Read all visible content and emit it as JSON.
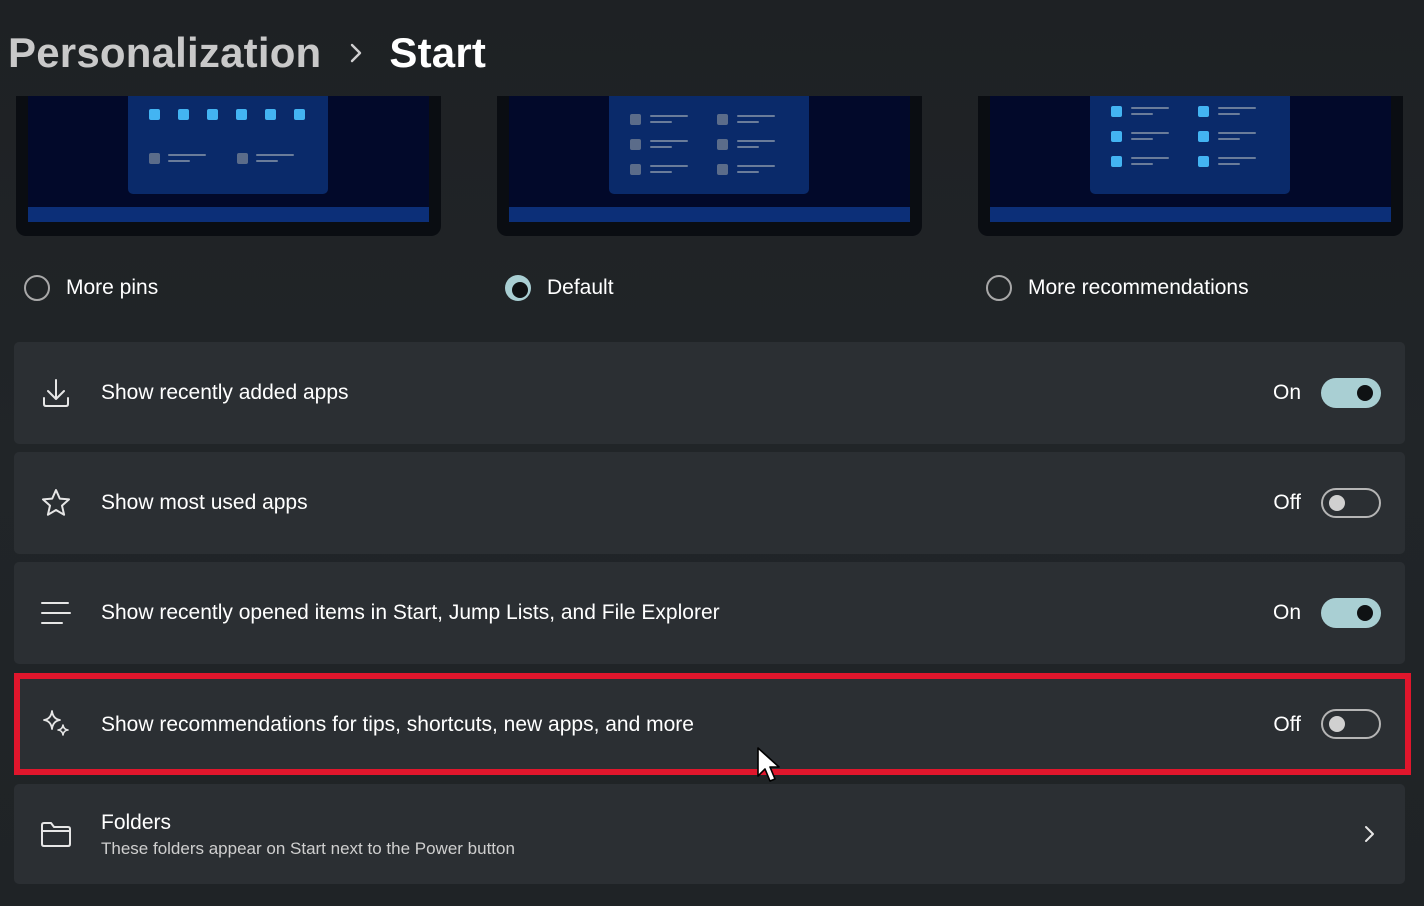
{
  "breadcrumb": {
    "parent": "Personalization",
    "separator_icon": "chevron-right-icon",
    "current": "Start"
  },
  "layout_options": [
    {
      "label": "More pins",
      "selected": false
    },
    {
      "label": "Default",
      "selected": true
    },
    {
      "label": "More recommendations",
      "selected": false
    }
  ],
  "settings": [
    {
      "icon": "download-icon",
      "label": "Show recently added apps",
      "state": "On",
      "toggle_on": true
    },
    {
      "icon": "star-icon",
      "label": "Show most used apps",
      "state": "Off",
      "toggle_on": false
    },
    {
      "icon": "list-icon",
      "label": "Show recently opened items in Start, Jump Lists, and File Explorer",
      "state": "On",
      "toggle_on": true
    },
    {
      "icon": "sparkle-icon",
      "label": "Show recommendations for tips, shortcuts, new apps, and more",
      "state": "Off",
      "toggle_on": false,
      "highlighted": true
    }
  ],
  "folders": {
    "icon": "folder-icon",
    "title": "Folders",
    "subtitle": "These folders appear on Start next to the Power button",
    "action_icon": "chevron-right-icon"
  },
  "colors": {
    "accent": "#a9cfd3",
    "highlight": "#e0162c",
    "card": "#2b2f33",
    "background": "#202326"
  }
}
